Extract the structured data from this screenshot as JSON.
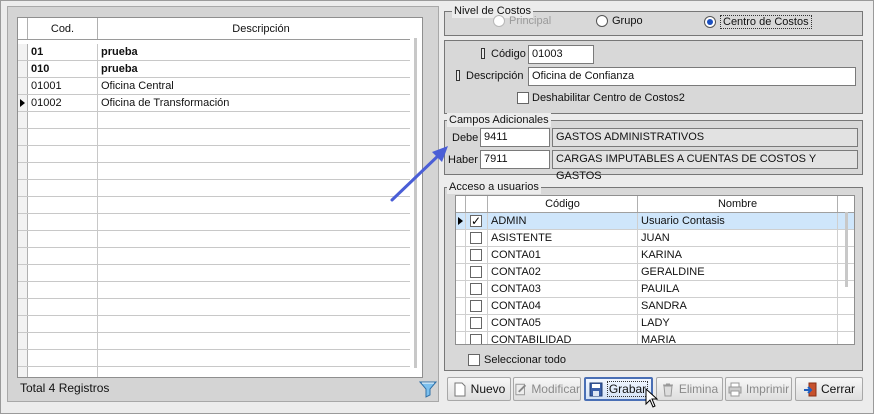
{
  "left_grid": {
    "columns": [
      "Cod.",
      "Descripción"
    ],
    "rows": [
      {
        "cod": "01",
        "desc": "prueba",
        "bold": true
      },
      {
        "cod": "010",
        "desc": "prueba",
        "bold": true
      },
      {
        "cod": "01001",
        "desc": "Oficina Central",
        "bold": false
      },
      {
        "cod": "01002",
        "desc": "Oficina de Transformación",
        "bold": false,
        "current": true
      }
    ],
    "total_label": "Total 4 Registros"
  },
  "nivel": {
    "title": "Nivel de Costos",
    "options": [
      {
        "label": "Principal",
        "state": "disabled"
      },
      {
        "label": "Grupo",
        "state": "off"
      },
      {
        "label": "Centro de Costos",
        "state": "on"
      }
    ]
  },
  "datos": {
    "codigo_label": "Código",
    "codigo_value": "01003",
    "descripcion_label": "Descripción",
    "descripcion_value": "Oficina de Confianza",
    "deshabilitar_label": "Deshabilitar Centro de Costos2"
  },
  "campos": {
    "title": "Campos Adicionales",
    "debe_label": "Debe",
    "debe_code": "9411",
    "debe_desc": "GASTOS ADMINISTRATIVOS",
    "haber_label": "Haber",
    "haber_code": "7911",
    "haber_desc": "CARGAS IMPUTABLES A CUENTAS DE COSTOS Y GASTOS"
  },
  "acceso": {
    "title": "Acceso a usuarios",
    "columns": [
      "Código",
      "Nombre"
    ],
    "rows": [
      {
        "codigo": "ADMIN",
        "nombre": "Usuario Contasis",
        "checked": true,
        "selected": true
      },
      {
        "codigo": "ASISTENTE",
        "nombre": "JUAN",
        "checked": false
      },
      {
        "codigo": "CONTA01",
        "nombre": "KARINA",
        "checked": false
      },
      {
        "codigo": "CONTA02",
        "nombre": "GERALDINE",
        "checked": false
      },
      {
        "codigo": "CONTA03",
        "nombre": "PAUILA",
        "checked": false
      },
      {
        "codigo": "CONTA04",
        "nombre": "SANDRA",
        "checked": false
      },
      {
        "codigo": "CONTA05",
        "nombre": "LADY",
        "checked": false
      },
      {
        "codigo": "CONTABILIDAD",
        "nombre": "MARIA",
        "checked": false
      }
    ],
    "select_all_label": "Seleccionar todo"
  },
  "toolbar": {
    "nuevo": "Nuevo",
    "modificar": "Modificar",
    "grabar": "Grabar",
    "elimina": "Elimina",
    "imprimir": "Imprimir",
    "cerrar": "Cerrar"
  },
  "colors": {
    "accent": "#1a4fbf",
    "selection": "#cfe6fb",
    "annotation_arrow": "#4a5ed6"
  }
}
